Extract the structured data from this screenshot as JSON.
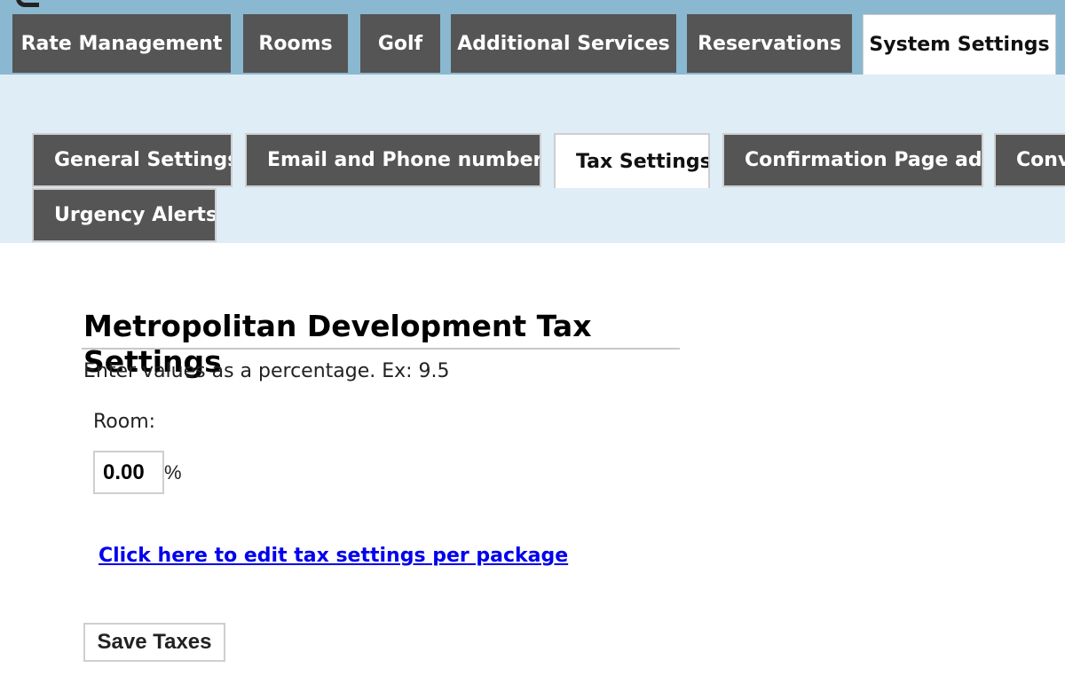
{
  "main_nav": {
    "tabs": [
      {
        "label": "Rate Management"
      },
      {
        "label": "Rooms"
      },
      {
        "label": "Golf"
      },
      {
        "label": "Additional Services"
      },
      {
        "label": "Reservations"
      },
      {
        "label": "System Settings",
        "active": true
      }
    ]
  },
  "sub_nav": {
    "tabs": [
      {
        "label": "General Settings"
      },
      {
        "label": "Email and Phone numbers"
      },
      {
        "label": "Tax Settings",
        "active": true
      },
      {
        "label": "Confirmation Page ads"
      },
      {
        "label": "Conv"
      },
      {
        "label": "Urgency Alerts"
      }
    ]
  },
  "tax_form": {
    "title": "Metropolitan Development Tax Settings",
    "hint": "Enter values as a percentage. Ex: 9.5",
    "room_label": "Room:",
    "room_value": "0.00",
    "percent_sign": "%",
    "package_link": "Click here to edit tax settings per package",
    "save_label": "Save Taxes"
  },
  "colors": {
    "header_bg": "#8ab8d0",
    "tab_bg": "#555555",
    "sub_area_bg": "#dfedf6",
    "link": "#0000ee"
  }
}
